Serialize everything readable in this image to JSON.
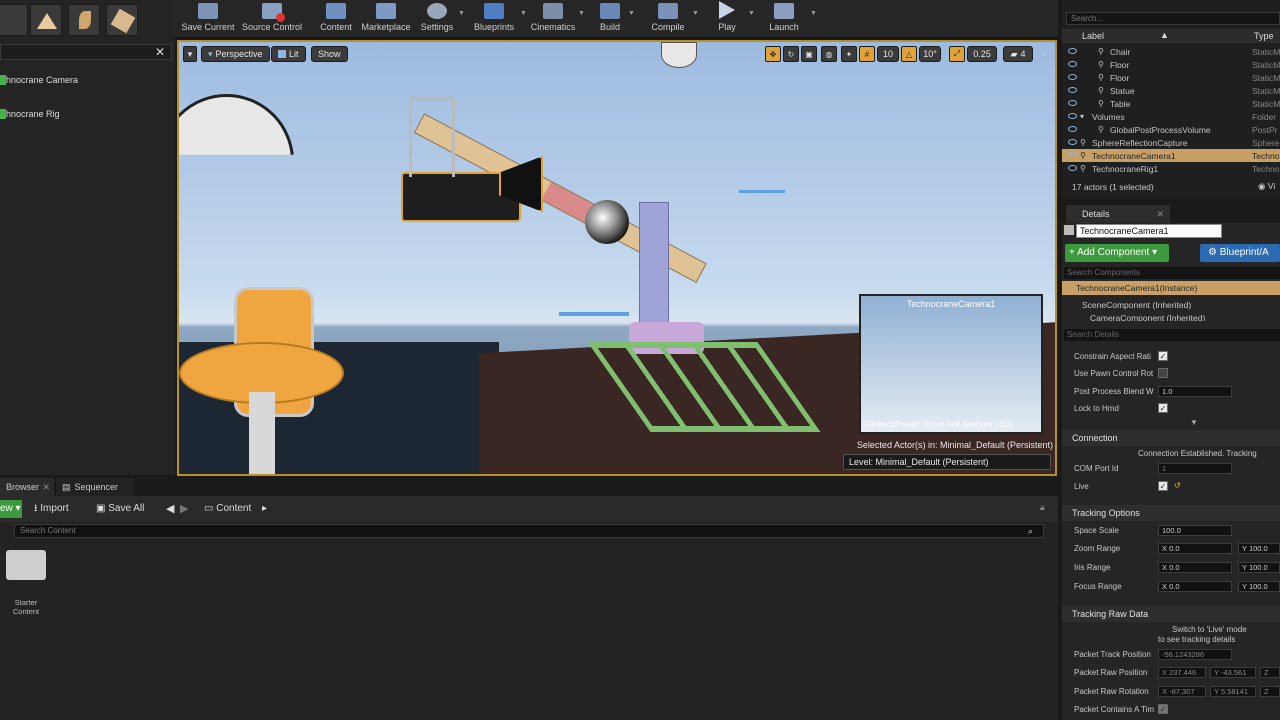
{
  "toolbar": {
    "items": [
      {
        "label": "Save Current"
      },
      {
        "label": "Source Control"
      },
      {
        "label": "Content"
      },
      {
        "label": "Marketplace"
      },
      {
        "label": "Settings"
      },
      {
        "label": "Blueprints"
      },
      {
        "label": "Cinematics"
      },
      {
        "label": "Build"
      },
      {
        "label": "Compile"
      },
      {
        "label": "Play"
      },
      {
        "label": "Launch"
      }
    ]
  },
  "place_panel": {
    "items": [
      {
        "label": "hnocrane Camera"
      },
      {
        "label": "hnocrane Rig"
      }
    ]
  },
  "viewport": {
    "perspective_label": "Perspective",
    "lit_label": "Lit",
    "show_label": "Show",
    "grid_snap": "10",
    "angle_snap": "10°",
    "scale_snap": "0.25",
    "camera_speed": "4",
    "preview_title": "TechnocraneCamera1",
    "preview_caption": "FilmbackPreset: 35mm Full Aperture | Zoo",
    "selected_actor": "Selected Actor(s) in:  Minimal_Default (Persistent)",
    "level": "Level:  Minimal_Default (Persistent)"
  },
  "outliner": {
    "search_placeholder": "Search...",
    "col_label": "Label",
    "col_type": "Type",
    "rows": [
      {
        "label": "Chair",
        "type": "StaticM"
      },
      {
        "label": "Floor",
        "type": "StaticM"
      },
      {
        "label": "Floor",
        "type": "StaticM"
      },
      {
        "label": "Statue",
        "type": "StaticM"
      },
      {
        "label": "Table",
        "type": "StaticM"
      },
      {
        "label": "Volumes",
        "type": "Folder"
      },
      {
        "label": "GlobalPostProcessVolume",
        "type": "PostPr"
      },
      {
        "label": "SphereReflectionCapture",
        "type": "Sphere"
      },
      {
        "label": "TechnocraneCamera1",
        "type": "Techno"
      },
      {
        "label": "TechnocraneRig1",
        "type": "Techno"
      }
    ],
    "status": "17 actors (1 selected)",
    "view_label": "Vi"
  },
  "details": {
    "tab_label": "Details",
    "name_value": "TechnocraneCamera1",
    "add_component": "+ Add Component ▾",
    "blueprint": "Blueprint/A",
    "search_components": "Search Components",
    "instance": "TechnocraneCamera1(Instance)",
    "scene_component": "SceneComponent (Inherited)",
    "camera_component": "CameraComponent (Inherited)",
    "search_details": "Search Details",
    "props": [
      {
        "label": "Constrain Aspect Rati"
      },
      {
        "label": "Use Pawn Control Rot"
      },
      {
        "label": "Post Process Blend W",
        "value": "1.0"
      },
      {
        "label": "Lock to Hmd"
      }
    ],
    "connection_header": "Connection",
    "connection_status": "Connection Established. Tracking",
    "com_port_label": "COM Port Id",
    "com_port_value": "1",
    "live_label": "Live",
    "tracking_header": "Tracking Options",
    "space_scale_label": "Space Scale",
    "space_scale_value": "100.0",
    "ranges": [
      {
        "label": "Zoom Range",
        "x": "X 0.0",
        "y": "Y 100.0"
      },
      {
        "label": "Iris Range",
        "x": "X 0.0",
        "y": "Y 100.0"
      },
      {
        "label": "Focus Range",
        "x": "X 0.0",
        "y": "Y 100.0"
      }
    ],
    "raw_header": "Tracking Raw Data",
    "raw_note1": "Switch to 'Live' mode",
    "raw_note2": "to see tracking details",
    "packet_track_label": "Packet Track Position",
    "packet_track_value": "-56.1243286",
    "packet_raw_pos_label": "Packet Raw Position",
    "packet_raw_pos_x": "X  237.446",
    "packet_raw_pos_y": "Y  -43.561",
    "packet_raw_pos_z": "Z",
    "packet_raw_rot_label": "Packet Raw Rotation",
    "packet_raw_rot_x": "X  -87.307",
    "packet_raw_rot_y": "Y  5.58141",
    "packet_raw_rot_z": "Z",
    "packet_contains_label": "Packet Contains A Tim"
  },
  "content_browser": {
    "tab1": "Browser",
    "tab2": "Sequencer",
    "new_label": "ew ▾",
    "import_label": "Import",
    "save_all_label": "Save All",
    "path_label": "Content",
    "search_placeholder": "Search Content",
    "folder_label1": "Starter",
    "folder_label2": "Content"
  },
  "colors": {
    "accent_orange": "#e0a33a",
    "add_green": "#3c9a3c",
    "blueprint_blue": "#2b6bb3",
    "selection": "#d4a056"
  }
}
